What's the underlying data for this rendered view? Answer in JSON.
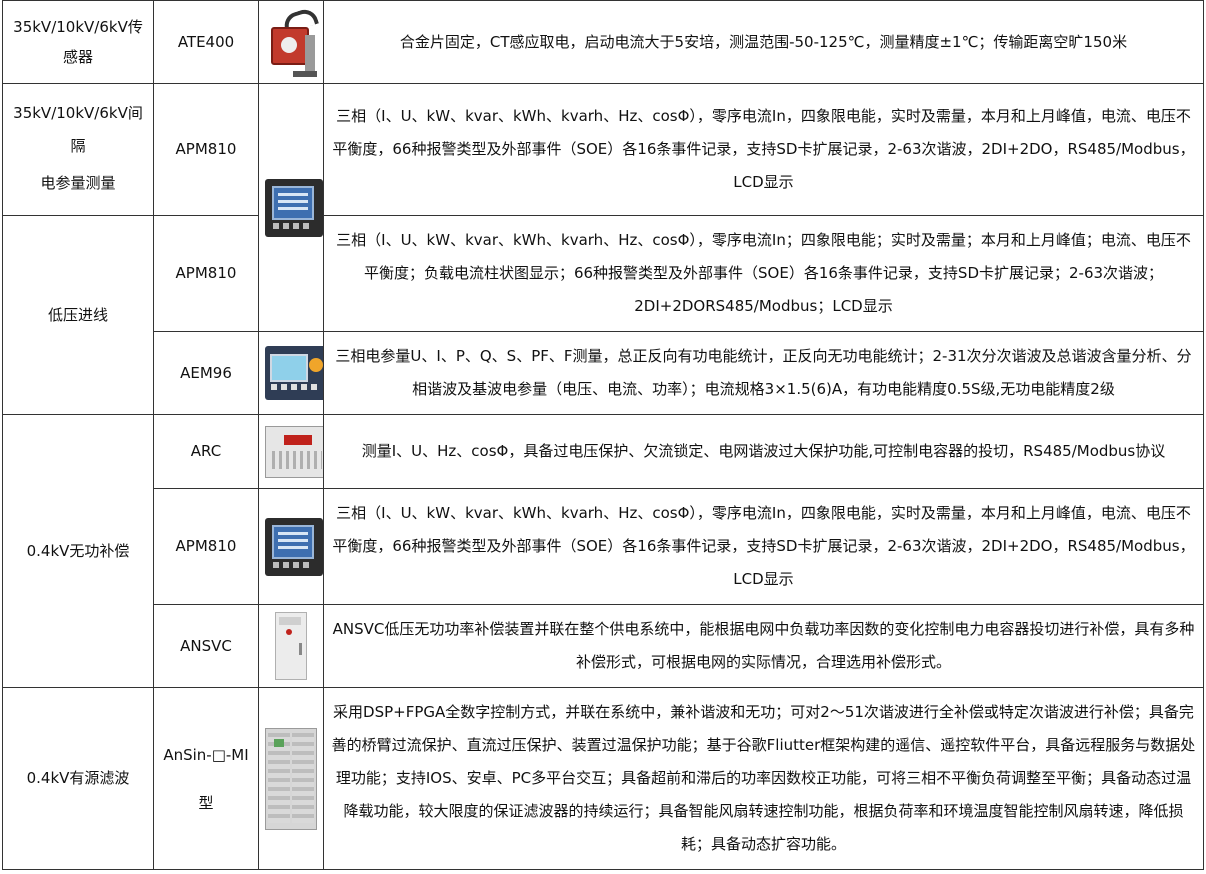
{
  "rows": [
    {
      "category": "35kV/10kV/6kV传感器",
      "model": "ATE400",
      "desc": "合金片固定，CT感应取电，启动电流大于5安培，测温范围-50-125℃，测量精度±1℃；传输距离空旷150米"
    },
    {
      "category_lines": [
        "35kV/10kV/6kV间隔",
        "电参量测量"
      ],
      "model": "APM810",
      "desc": "三相（I、U、kW、kvar、kWh、kvarh、Hz、cosΦ），零序电流In，四象限电能，实时及需量，本月和上月峰值，电流、电压不平衡度，66种报警类型及外部事件（SOE）各16条事件记录，支持SD卡扩展记录，2-63次谐波，2DI+2DO，RS485/Modbus，LCD显示"
    },
    {
      "category": "低压进线",
      "model": "APM810",
      "desc": "三相（I、U、kW、kvar、kWh、kvarh、Hz、cosΦ），零序电流In；四象限电能；实时及需量；本月和上月峰值；电流、电压不平衡度；负载电流柱状图显示；66种报警类型及外部事件（SOE）各16条事件记录，支持SD卡扩展记录；2-63次谐波；2DI+2DORS485/Modbus；LCD显示"
    },
    {
      "model": "AEM96",
      "desc": "三相电参量U、I、P、Q、S、PF、F测量，总正反向有功电能统计，正反向无功电能统计；2-31次分次谐波及总谐波含量分析、分相谐波及基波电参量（电压、电流、功率）；电流规格3×1.5(6)A，有功电能精度0.5S级,无功电能精度2级"
    },
    {
      "category": "0.4kV无功补偿",
      "model": "ARC",
      "desc": "测量I、U、Hz、cosΦ，具备过电压保护、欠流锁定、电网谐波过大保护功能,可控制电容器的投切，RS485/Modbus协议"
    },
    {
      "model": "APM810",
      "desc": "三相（I、U、kW、kvar、kWh、kvarh、Hz、cosΦ），零序电流In，四象限电能，实时及需量，本月和上月峰值，电流、电压不平衡度，66种报警类型及外部事件（SOE）各16条事件记录，支持SD卡扩展记录，2-63次谐波，2DI+2DO，RS485/Modbus，LCD显示"
    },
    {
      "model": "ANSVC",
      "desc": "ANSVC低压无功功率补偿装置并联在整个供电系统中，能根据电网中负载功率因数的变化控制电力电容器投切进行补偿，具有多种补偿形式，可根据电网的实际情况，合理选用补偿形式。"
    },
    {
      "category": "0.4kV有源滤波",
      "model": "AnSin-□-MI 型",
      "desc": "采用DSP+FPGA全数字控制方式，并联在系统中，兼补谐波和无功；可对2～51次谐波进行全补偿或特定次谐波进行补偿；具备完善的桥臂过流保护、直流过压保护、装置过温保护功能；基于谷歌Fliutter框架构建的遥信、遥控软件平台，具备远程服务与数据处理功能；支持IOS、安卓、PC多平台交互；具备超前和滞后的功率因数校正功能，可将三相不平衡负荷调整至平衡；具备动态过温降载功能，较大限度的保证滤波器的持续运行；具备智能风扇转速控制功能，根据负荷率和环境温度智能控制风扇转速，降低损耗；具备动态扩容功能。"
    }
  ]
}
